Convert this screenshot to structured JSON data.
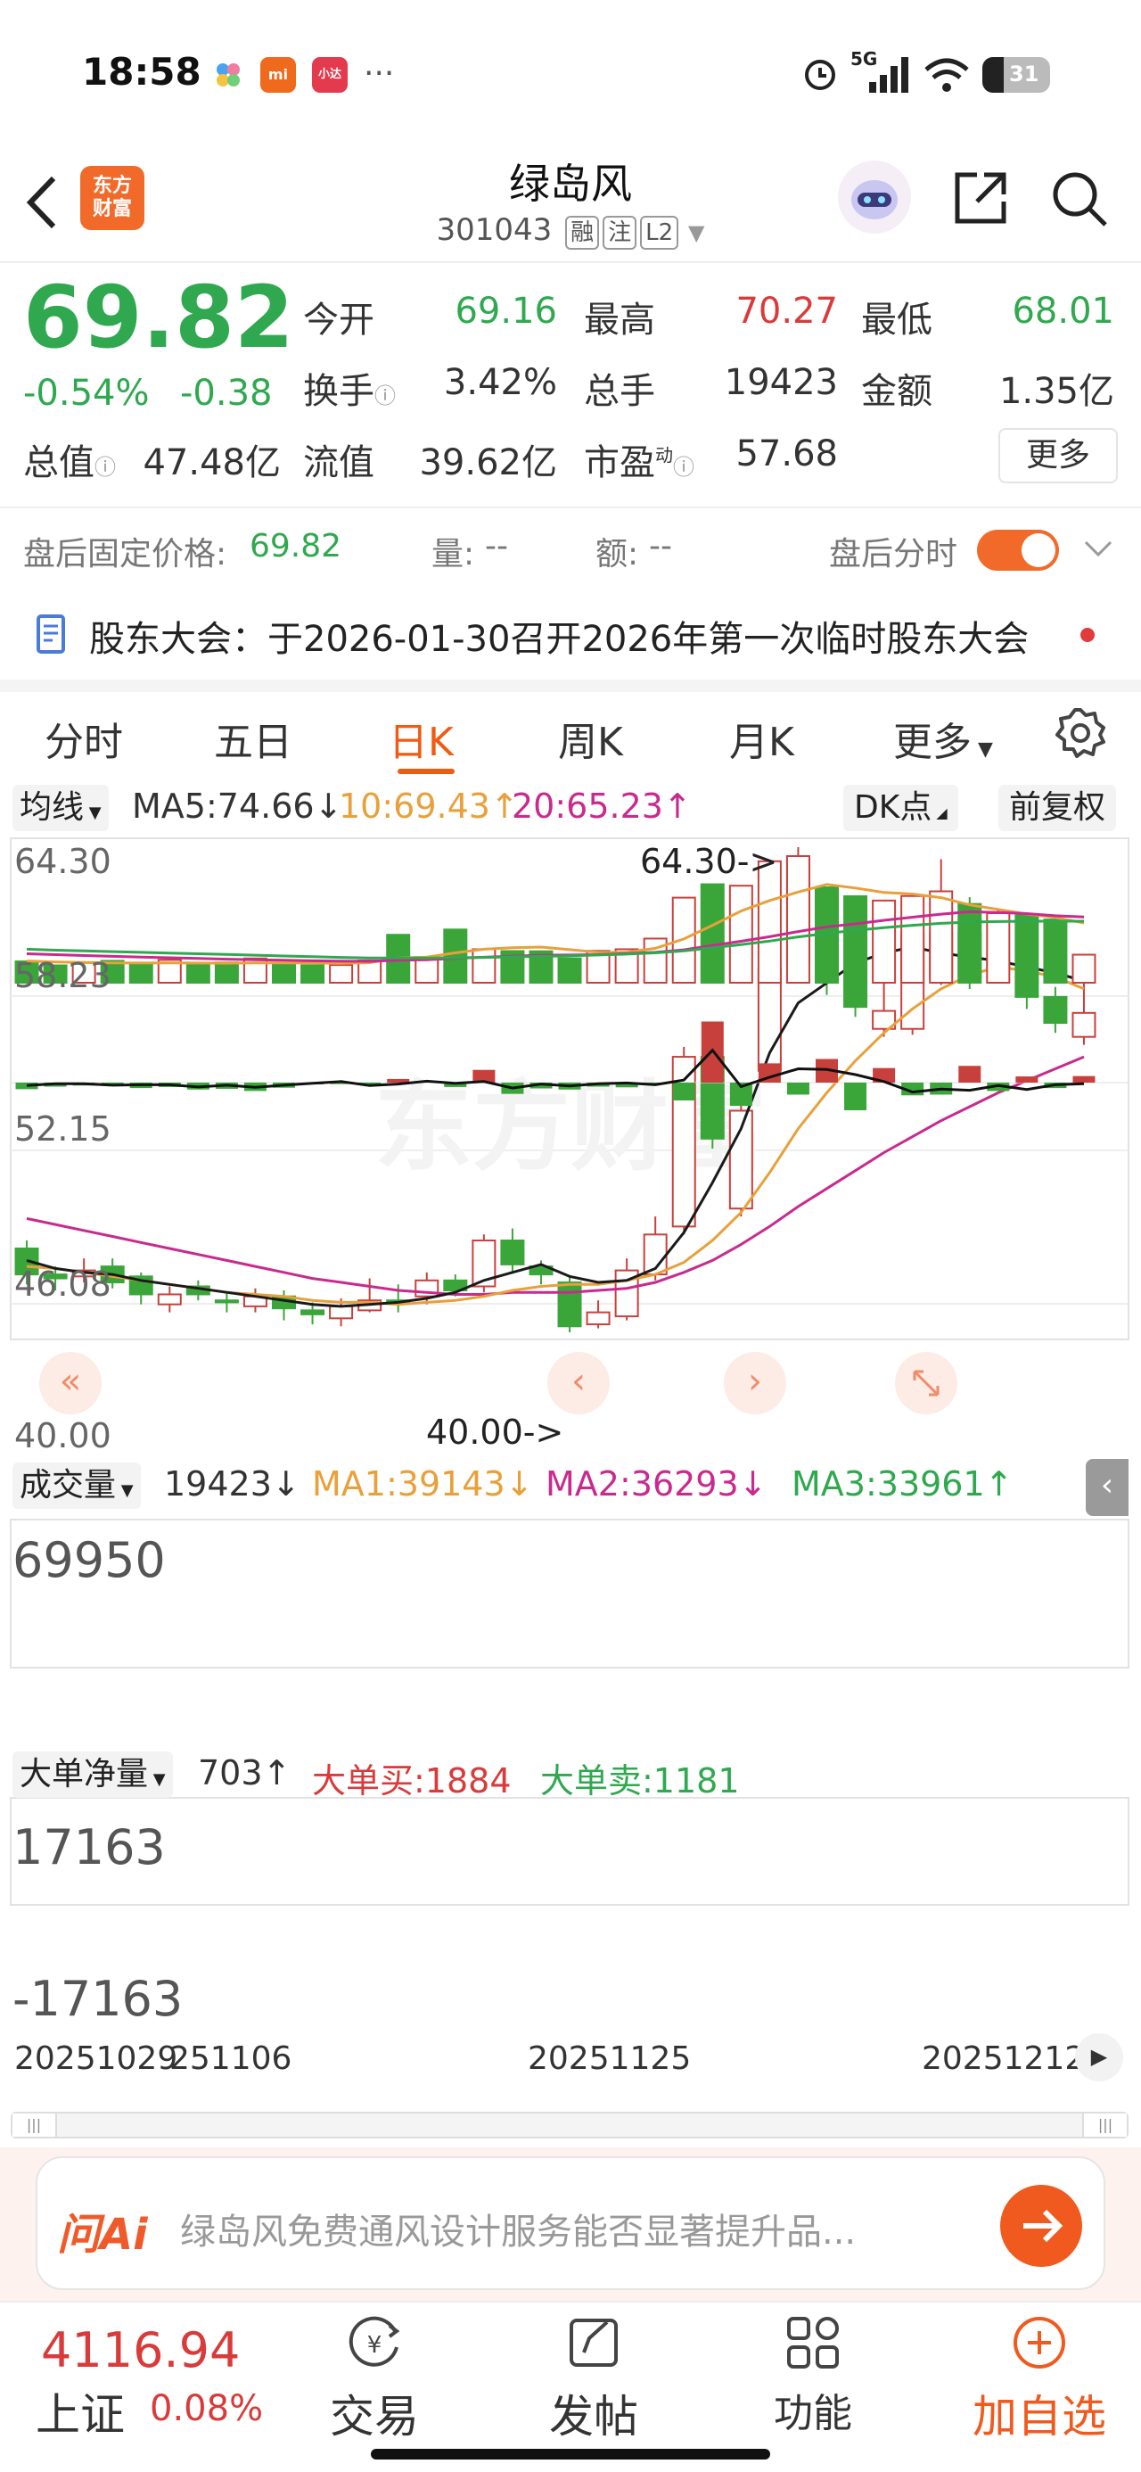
{
  "status_bar": {
    "time": "18:58",
    "app_icons": [
      "mi",
      "小达"
    ],
    "battery": "31",
    "network": "5G"
  },
  "header": {
    "name": "绿岛风",
    "code": "301043",
    "tags": [
      "融",
      "注",
      "L2"
    ],
    "logo_text_1": "东方",
    "logo_text_2": "财富"
  },
  "quote": {
    "price": "69.82",
    "change_pct": "-0.54%",
    "change": "-0.38",
    "rows": [
      [
        {
          "label": "今开",
          "value": "69.16",
          "color": "green"
        },
        {
          "label": "最高",
          "value": "70.27",
          "color": "red"
        },
        {
          "label": "最低",
          "value": "68.01",
          "color": "green"
        }
      ],
      [
        {
          "label": "换手",
          "value": "3.42%",
          "color": "dark"
        },
        {
          "label": "总手",
          "value": "19423",
          "color": "dark"
        },
        {
          "label": "金额",
          "value": "1.35亿",
          "color": "dark"
        }
      ],
      [
        {
          "label": "总值",
          "value": "47.48亿",
          "color": "dark"
        },
        {
          "label": "流值",
          "value": "39.62亿",
          "color": "dark"
        },
        {
          "label": "市盈",
          "value": "57.68",
          "color": "dark"
        }
      ]
    ],
    "pe_superscript": "动",
    "more_label": "更多"
  },
  "after_hours": {
    "label": "盘后固定价格:",
    "price": "69.82",
    "volume_label": "量:",
    "volume": "--",
    "amount_label": "额:",
    "amount": "--",
    "toggle_label": "盘后分时"
  },
  "notice": {
    "text": "股东大会：于2026-01-30召开2026年第一次临时股东大会"
  },
  "tabs": [
    "分时",
    "五日",
    "日K",
    "周K",
    "月K",
    "更多"
  ],
  "active_tab": 2,
  "chart": {
    "ma_select": "均线",
    "ma5": "MA5:74.66",
    "ma10": "10:69.43",
    "ma20": "20:65.23",
    "indicator": "DK点",
    "adjust": "前复权",
    "y_labels": [
      "64.30",
      "58.23",
      "52.15",
      "46.08",
      "40.00"
    ],
    "high_annotation": "64.30->",
    "low_annotation": "40.00->",
    "vol_select": "成交量",
    "vol": "19423",
    "vol_ma1": "MA1:39143",
    "vol_ma2": "MA2:36293",
    "vol_ma3": "MA3:33961",
    "vol_max": "69950",
    "flow_select": "大单净量",
    "flow": "703",
    "flow_buy": "大单买:1884",
    "flow_sell": "大单卖:1181",
    "flow_max": "17163",
    "flow_min": "-17163",
    "x_labels": [
      "20251029",
      "251106",
      "20251125",
      "20251212"
    ],
    "watermark": "东方财富"
  },
  "chart_data": {
    "type": "candlestick",
    "ylim": [
      40.0,
      64.3
    ],
    "candles": [
      {
        "o": 44.2,
        "c": 42.9,
        "h": 44.6,
        "l": 42.4
      },
      {
        "o": 42.9,
        "c": 42.7,
        "h": 43.3,
        "l": 42.1
      },
      {
        "o": 42.8,
        "c": 43.1,
        "h": 43.7,
        "l": 42.5
      },
      {
        "o": 43.3,
        "c": 42.5,
        "h": 43.7,
        "l": 42.2
      },
      {
        "o": 42.8,
        "c": 41.9,
        "h": 43.0,
        "l": 41.4
      },
      {
        "o": 41.4,
        "c": 41.9,
        "h": 42.3,
        "l": 41.0
      },
      {
        "o": 42.3,
        "c": 41.9,
        "h": 42.6,
        "l": 41.6
      },
      {
        "o": 41.6,
        "c": 41.5,
        "h": 42.0,
        "l": 41.0
      },
      {
        "o": 41.3,
        "c": 41.8,
        "h": 42.2,
        "l": 41.0
      },
      {
        "o": 41.8,
        "c": 41.2,
        "h": 42.1,
        "l": 40.6
      },
      {
        "o": 41.1,
        "c": 40.9,
        "h": 41.5,
        "l": 40.4
      },
      {
        "o": 40.7,
        "c": 41.3,
        "h": 41.7,
        "l": 40.3
      },
      {
        "o": 41.1,
        "c": 41.6,
        "h": 42.7,
        "l": 41.0
      },
      {
        "o": 41.6,
        "c": 41.5,
        "h": 42.4,
        "l": 41.0
      },
      {
        "o": 41.8,
        "c": 42.6,
        "h": 43.0,
        "l": 41.4
      },
      {
        "o": 42.6,
        "c": 42.1,
        "h": 42.9,
        "l": 41.8
      },
      {
        "o": 42.3,
        "c": 44.6,
        "h": 44.9,
        "l": 42.0
      },
      {
        "o": 44.6,
        "c": 43.4,
        "h": 45.2,
        "l": 43.0
      },
      {
        "o": 43.3,
        "c": 42.9,
        "h": 43.6,
        "l": 42.4
      },
      {
        "o": 42.5,
        "c": 40.3,
        "h": 42.8,
        "l": 40.0
      },
      {
        "o": 40.4,
        "c": 41.0,
        "h": 41.6,
        "l": 40.2
      },
      {
        "o": 40.8,
        "c": 43.1,
        "h": 43.7,
        "l": 40.6
      },
      {
        "o": 42.9,
        "c": 44.9,
        "h": 45.8,
        "l": 42.6
      },
      {
        "o": 45.3,
        "c": 53.8,
        "h": 54.3,
        "l": 44.9
      },
      {
        "o": 53.8,
        "c": 49.7,
        "h": 54.0,
        "l": 49.2
      },
      {
        "o": 46.2,
        "c": 51.1,
        "h": 51.9,
        "l": 45.8
      },
      {
        "o": 53.1,
        "c": 58.2,
        "h": 61.2,
        "l": 52.6
      },
      {
        "o": 58.5,
        "c": 63.8,
        "h": 64.3,
        "l": 57.8
      },
      {
        "o": 60.0,
        "c": 58.6,
        "h": 60.3,
        "l": 56.9
      },
      {
        "o": 57.5,
        "c": 56.3,
        "h": 57.9,
        "l": 55.8
      },
      {
        "o": 55.2,
        "c": 56.1,
        "h": 57.8,
        "l": 54.8
      },
      {
        "o": 55.2,
        "c": 60.0,
        "h": 61.8,
        "l": 54.9
      },
      {
        "o": 57.8,
        "c": 60.0,
        "h": 63.7,
        "l": 57.4
      },
      {
        "o": 60.0,
        "c": 57.8,
        "h": 61.8,
        "l": 57.2
      },
      {
        "o": 58.2,
        "c": 58.6,
        "h": 61.2,
        "l": 57.6
      },
      {
        "o": 57.5,
        "c": 56.8,
        "h": 58.1,
        "l": 56.2
      },
      {
        "o": 56.8,
        "c": 55.5,
        "h": 57.3,
        "l": 55.0
      },
      {
        "o": 54.8,
        "c": 56.0,
        "h": 58.0,
        "l": 54.4
      }
    ],
    "ma5": [
      43.6,
      43.2,
      43.0,
      42.9,
      42.6,
      42.4,
      42.2,
      42.0,
      41.8,
      41.6,
      41.4,
      41.3,
      41.4,
      41.5,
      41.7,
      42.0,
      42.6,
      43.0,
      43.4,
      42.8,
      42.5,
      42.6,
      43.2,
      45.0,
      47.5,
      50.2,
      54.0,
      56.5,
      57.5,
      58.5,
      59.0,
      59.3,
      59.0,
      58.8,
      58.6,
      58.3,
      58.0,
      57.6
    ],
    "ma10": [
      43.3,
      43.2,
      43.0,
      42.8,
      42.6,
      42.4,
      42.2,
      42.0,
      41.9,
      41.8,
      41.6,
      41.5,
      41.5,
      41.4,
      41.5,
      41.6,
      41.8,
      42.1,
      42.3,
      42.4,
      42.4,
      42.6,
      42.9,
      43.5,
      44.6,
      46.0,
      48.0,
      50.2,
      52.0,
      53.6,
      55.0,
      56.2,
      57.2,
      57.9,
      58.3,
      58.1,
      57.8,
      57.2
    ],
    "ma20": [
      45.7,
      45.4,
      45.1,
      44.8,
      44.5,
      44.2,
      43.9,
      43.6,
      43.3,
      43.0,
      42.7,
      42.5,
      42.3,
      42.1,
      42.0,
      41.9,
      41.9,
      42.0,
      42.0,
      42.0,
      42.1,
      42.2,
      42.5,
      43.0,
      43.6,
      44.4,
      45.3,
      46.3,
      47.2,
      48.1,
      49.0,
      49.8,
      50.6,
      51.3,
      52.0,
      52.6,
      53.2,
      53.8
    ],
    "volume": [
      11800,
      9600,
      11000,
      12100,
      10600,
      12600,
      9800,
      11200,
      13400,
      10100,
      9600,
      9800,
      12300,
      26500,
      14200,
      29400,
      18500,
      17500,
      17400,
      13500,
      17600,
      18500,
      24400,
      47000,
      54400,
      53600,
      67100,
      69950,
      52700,
      47800,
      45400,
      47900,
      50500,
      43500,
      38400,
      37300,
      34900,
      15500
    ],
    "flow": [
      -1800,
      -1100,
      -800,
      -700,
      -1500,
      -1200,
      -1900,
      -1700,
      -2300,
      -1400,
      -500,
      -400,
      -700,
      1000,
      300,
      -1200,
      3500,
      -3100,
      -1600,
      -1900,
      -1100,
      -1300,
      -500,
      -4900,
      16800,
      -6400,
      5300,
      -3300,
      6500,
      -7600,
      4000,
      -3500,
      -3300,
      4600,
      -2300,
      1700,
      -1500,
      1800
    ],
    "flow_line": [
      -800,
      -300,
      -300,
      -700,
      -600,
      -600,
      -1200,
      -700,
      -1300,
      -700,
      -200,
      300,
      -800,
      -400,
      400,
      -200,
      300,
      -1500,
      -400,
      -900,
      -300,
      -100,
      -600,
      700,
      8900,
      -1100,
      1500,
      3800,
      3600,
      2200,
      300,
      -2600,
      -1800,
      -2100,
      -800,
      -1900,
      -600,
      -300
    ],
    "volume_ma": [
      {
        "name": "MA1",
        "values": [
          12000,
          11500,
          11200,
          11000,
          10900,
          11000,
          10900,
          10800,
          11000,
          11000,
          10900,
          10700,
          11100,
          13700,
          14200,
          16500,
          18500,
          19300,
          19700,
          18300,
          16800,
          16800,
          19000,
          24200,
          31700,
          39600,
          45400,
          50100,
          54300,
          52300,
          49900,
          49000,
          47000,
          43000,
          40500,
          38000,
          36000,
          33000
        ]
      },
      {
        "name": "MA2",
        "values": [
          16000,
          15500,
          15000,
          14600,
          14200,
          13800,
          13400,
          13000,
          12700,
          12400,
          12100,
          11900,
          11800,
          12400,
          12700,
          13500,
          14100,
          14700,
          15200,
          15300,
          15500,
          16100,
          16800,
          18200,
          20600,
          22900,
          25400,
          28300,
          30900,
          32500,
          34500,
          36200,
          37900,
          39200,
          38800,
          38200,
          37000,
          36300
        ]
      },
      {
        "name": "MA3",
        "values": [
          18500,
          18000,
          17600,
          17200,
          16800,
          16400,
          16000,
          15600,
          15200,
          14800,
          14400,
          14000,
          13700,
          13700,
          13600,
          13800,
          14000,
          14300,
          14600,
          14900,
          15300,
          15800,
          16500,
          17600,
          19300,
          21100,
          23000,
          25300,
          27300,
          28900,
          30400,
          31700,
          32800,
          33500,
          33800,
          34000,
          34000,
          34000
        ]
      }
    ]
  },
  "ai_bar": {
    "logo": "问Ai",
    "placeholder": "绿岛风免费通风设计服务能否显著提升品..."
  },
  "bottom_nav": {
    "index_price": "4116.94",
    "index_name": "上证",
    "index_change": "0.08%",
    "items": [
      "交易",
      "发帖",
      "功能",
      "加自选"
    ]
  }
}
